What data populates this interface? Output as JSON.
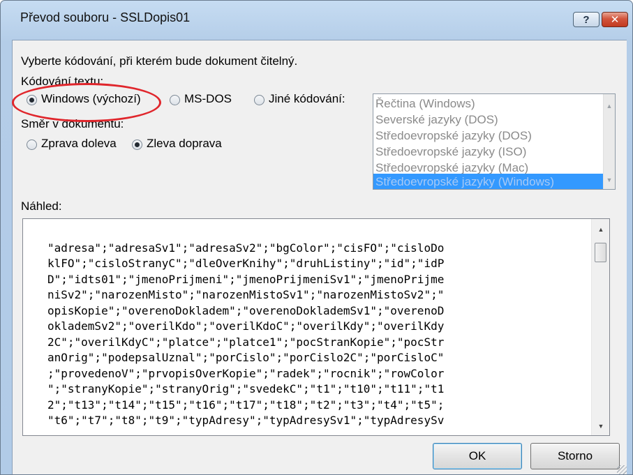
{
  "window": {
    "title": "Převod souboru - SSLDopis01",
    "help_glyph": "?",
    "close_glyph": "✕"
  },
  "instruction": "Vyberte kódování, při kterém bude dokument čitelný.",
  "encoding": {
    "label": "Kódování textu:",
    "options": [
      {
        "label": "Windows (výchozí)",
        "checked": true
      },
      {
        "label": "MS-DOS",
        "checked": false
      },
      {
        "label": "Jiné kódování:",
        "checked": false
      }
    ],
    "list": [
      {
        "label": "Řečtina (Windows)",
        "selected": false
      },
      {
        "label": "Severské jazyky (DOS)",
        "selected": false
      },
      {
        "label": "Středoevropské jazyky (DOS)",
        "selected": false
      },
      {
        "label": "Středoevropské jazyky (ISO)",
        "selected": false
      },
      {
        "label": "Středoevropské jazyky (Mac)",
        "selected": false
      },
      {
        "label": "Středoevropské jazyky (Windows)",
        "selected": true
      }
    ]
  },
  "direction": {
    "label": "Směr v dokumentu:",
    "options": [
      {
        "label": "Zprava doleva",
        "checked": false
      },
      {
        "label": "Zleva doprava",
        "checked": true
      }
    ]
  },
  "preview": {
    "label": "Náhled:",
    "lines": [
      "\"adresa\";\"adresaSv1\";\"adresaSv2\";\"bgColor\";\"cisFO\";\"cisloDo",
      "klFO\";\"cisloStranyC\";\"dleOverKnihy\";\"druhListiny\";\"id\";\"idP",
      "D\";\"idts01\";\"jmenoPrijmeni\";\"jmenoPrijmeniSv1\";\"jmenoPrijme",
      "niSv2\";\"narozenMisto\";\"narozenMistoSv1\";\"narozenMistoSv2\";\"",
      "opisKopie\";\"overenoDokladem\";\"overenoDoklademSv1\";\"overenoD",
      "oklademSv2\";\"overilKdo\";\"overilKdoC\";\"overilKdy\";\"overilKdy",
      "2C\";\"overilKdyC\";\"platce\";\"platce1\";\"pocStranKopie\";\"pocStr",
      "anOrig\";\"podepsalUznal\";\"porCislo\";\"porCislo2C\";\"porCisloC\"",
      ";\"provedenoV\";\"prvopisOverKopie\";\"radek\";\"rocnik\";\"rowColor",
      "\";\"stranyKopie\";\"stranyOrig\";\"svedekC\";\"t1\";\"t10\";\"t11\";\"t1",
      "2\";\"t13\";\"t14\";\"t15\";\"t16\";\"t17\";\"t18\";\"t2\";\"t3\";\"t4\";\"t5\";",
      "\"t6\";\"t7\";\"t8\";\"t9\";\"typAdresy\";\"typAdresySv1\";\"typAdresySv"
    ]
  },
  "buttons": {
    "ok": "OK",
    "cancel": "Storno"
  },
  "colors": {
    "annotation": "#e0262c",
    "selection": "#3399ff"
  }
}
